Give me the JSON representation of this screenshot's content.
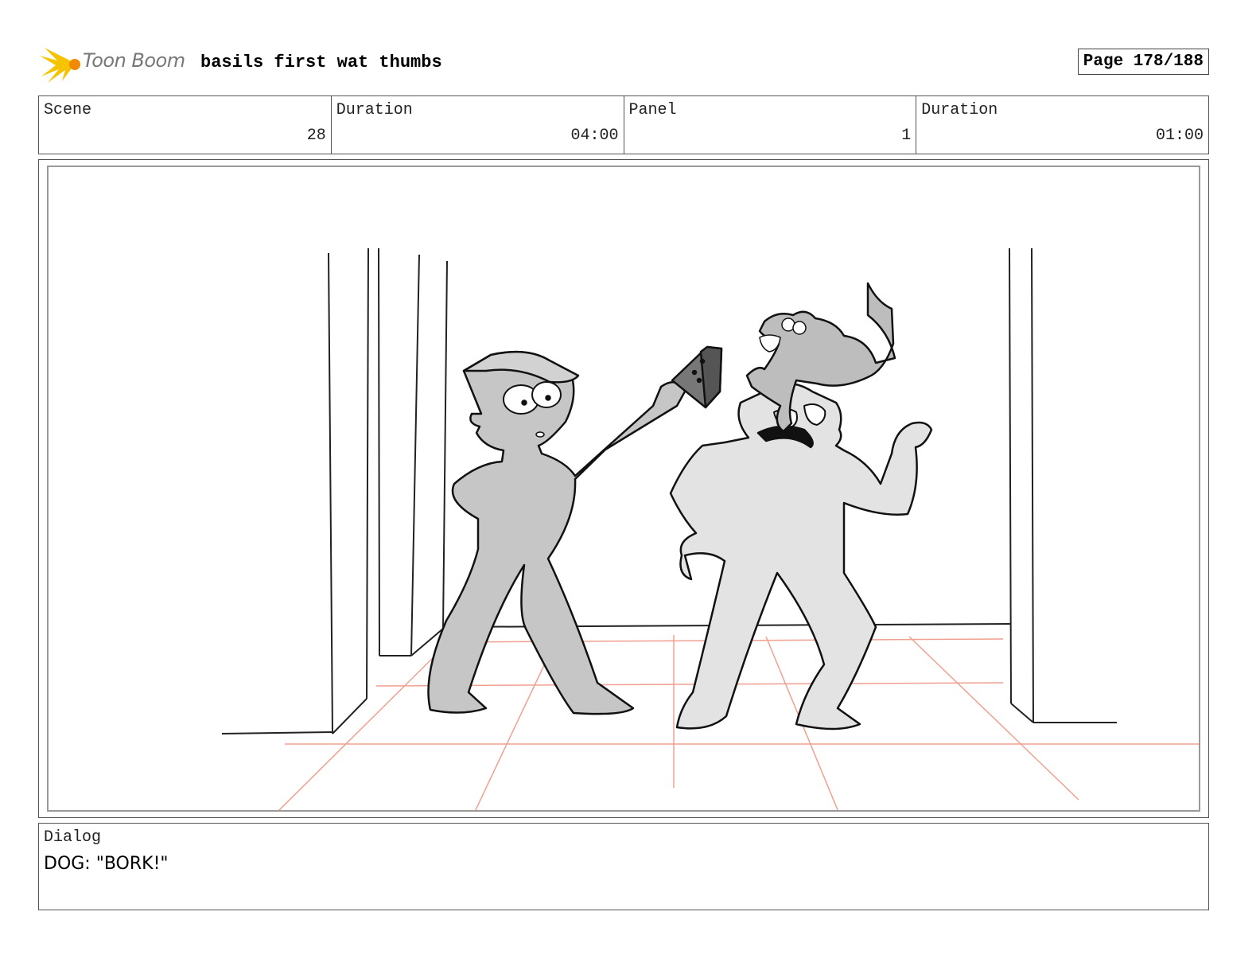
{
  "header": {
    "logo_text": "Toon Boom",
    "project_title": "basils first wat thumbs",
    "page_label": "Page 178/188"
  },
  "info": {
    "scene_label": "Scene",
    "scene_value": "28",
    "scene_duration_label": "Duration",
    "scene_duration_value": "04:00",
    "panel_label": "Panel",
    "panel_value": "1",
    "panel_duration_label": "Duration",
    "panel_duration_value": "01:00"
  },
  "dialog": {
    "label": "Dialog",
    "text": "DOG: \"BORK!\""
  },
  "colors": {
    "logo_yellow": "#f5c400",
    "logo_orange": "#f08a00",
    "figure_dark": "#c6c6c6",
    "figure_light": "#e3e3e3",
    "floor_lines": "#f0a090"
  }
}
